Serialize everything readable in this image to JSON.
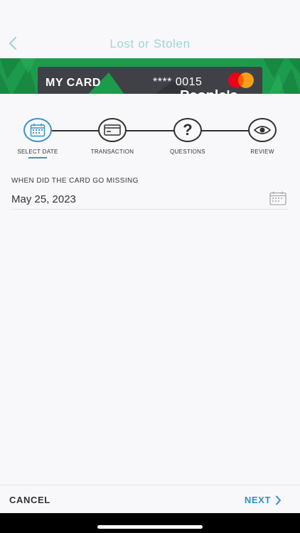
{
  "header": {
    "title": "Lost or Stolen"
  },
  "card": {
    "name": "MY CARD",
    "number": "**** 0015",
    "brand_text": "People's",
    "network_logo": "mastercard-logo"
  },
  "stepper": {
    "steps": [
      {
        "label": "SELECT DATE",
        "icon": "calendar-icon",
        "active": true
      },
      {
        "label": "TRANSACTION",
        "icon": "credit-card-icon",
        "active": false
      },
      {
        "label": "QUESTIONS",
        "icon": "question-mark-icon",
        "active": false
      },
      {
        "label": "REVIEW",
        "icon": "eye-icon",
        "active": false
      }
    ]
  },
  "form": {
    "date_label": "WHEN DID THE CARD GO MISSING",
    "date_value": "May 25, 2023"
  },
  "footer": {
    "cancel_label": "CANCEL",
    "next_label": "NEXT"
  },
  "colors": {
    "accent": "#2f8ec5",
    "title": "#9fd3df",
    "banner_green": "#1d9b4c",
    "card_gray": "#3f4146"
  }
}
